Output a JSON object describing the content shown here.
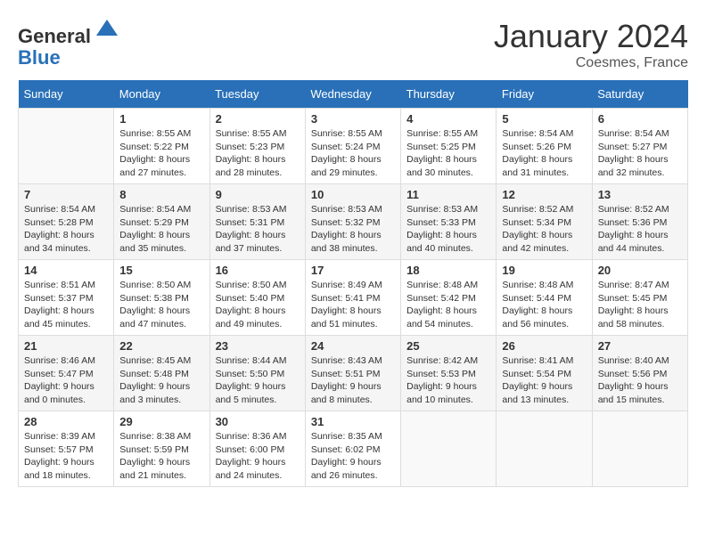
{
  "header": {
    "logo_line1": "General",
    "logo_line2": "Blue",
    "month_title": "January 2024",
    "location": "Coesmes, France"
  },
  "days_of_week": [
    "Sunday",
    "Monday",
    "Tuesday",
    "Wednesday",
    "Thursday",
    "Friday",
    "Saturday"
  ],
  "weeks": [
    [
      {
        "day": "",
        "info": ""
      },
      {
        "day": "1",
        "info": "Sunrise: 8:55 AM\nSunset: 5:22 PM\nDaylight: 8 hours\nand 27 minutes."
      },
      {
        "day": "2",
        "info": "Sunrise: 8:55 AM\nSunset: 5:23 PM\nDaylight: 8 hours\nand 28 minutes."
      },
      {
        "day": "3",
        "info": "Sunrise: 8:55 AM\nSunset: 5:24 PM\nDaylight: 8 hours\nand 29 minutes."
      },
      {
        "day": "4",
        "info": "Sunrise: 8:55 AM\nSunset: 5:25 PM\nDaylight: 8 hours\nand 30 minutes."
      },
      {
        "day": "5",
        "info": "Sunrise: 8:54 AM\nSunset: 5:26 PM\nDaylight: 8 hours\nand 31 minutes."
      },
      {
        "day": "6",
        "info": "Sunrise: 8:54 AM\nSunset: 5:27 PM\nDaylight: 8 hours\nand 32 minutes."
      }
    ],
    [
      {
        "day": "7",
        "info": "Sunrise: 8:54 AM\nSunset: 5:28 PM\nDaylight: 8 hours\nand 34 minutes."
      },
      {
        "day": "8",
        "info": "Sunrise: 8:54 AM\nSunset: 5:29 PM\nDaylight: 8 hours\nand 35 minutes."
      },
      {
        "day": "9",
        "info": "Sunrise: 8:53 AM\nSunset: 5:31 PM\nDaylight: 8 hours\nand 37 minutes."
      },
      {
        "day": "10",
        "info": "Sunrise: 8:53 AM\nSunset: 5:32 PM\nDaylight: 8 hours\nand 38 minutes."
      },
      {
        "day": "11",
        "info": "Sunrise: 8:53 AM\nSunset: 5:33 PM\nDaylight: 8 hours\nand 40 minutes."
      },
      {
        "day": "12",
        "info": "Sunrise: 8:52 AM\nSunset: 5:34 PM\nDaylight: 8 hours\nand 42 minutes."
      },
      {
        "day": "13",
        "info": "Sunrise: 8:52 AM\nSunset: 5:36 PM\nDaylight: 8 hours\nand 44 minutes."
      }
    ],
    [
      {
        "day": "14",
        "info": "Sunrise: 8:51 AM\nSunset: 5:37 PM\nDaylight: 8 hours\nand 45 minutes."
      },
      {
        "day": "15",
        "info": "Sunrise: 8:50 AM\nSunset: 5:38 PM\nDaylight: 8 hours\nand 47 minutes."
      },
      {
        "day": "16",
        "info": "Sunrise: 8:50 AM\nSunset: 5:40 PM\nDaylight: 8 hours\nand 49 minutes."
      },
      {
        "day": "17",
        "info": "Sunrise: 8:49 AM\nSunset: 5:41 PM\nDaylight: 8 hours\nand 51 minutes."
      },
      {
        "day": "18",
        "info": "Sunrise: 8:48 AM\nSunset: 5:42 PM\nDaylight: 8 hours\nand 54 minutes."
      },
      {
        "day": "19",
        "info": "Sunrise: 8:48 AM\nSunset: 5:44 PM\nDaylight: 8 hours\nand 56 minutes."
      },
      {
        "day": "20",
        "info": "Sunrise: 8:47 AM\nSunset: 5:45 PM\nDaylight: 8 hours\nand 58 minutes."
      }
    ],
    [
      {
        "day": "21",
        "info": "Sunrise: 8:46 AM\nSunset: 5:47 PM\nDaylight: 9 hours\nand 0 minutes."
      },
      {
        "day": "22",
        "info": "Sunrise: 8:45 AM\nSunset: 5:48 PM\nDaylight: 9 hours\nand 3 minutes."
      },
      {
        "day": "23",
        "info": "Sunrise: 8:44 AM\nSunset: 5:50 PM\nDaylight: 9 hours\nand 5 minutes."
      },
      {
        "day": "24",
        "info": "Sunrise: 8:43 AM\nSunset: 5:51 PM\nDaylight: 9 hours\nand 8 minutes."
      },
      {
        "day": "25",
        "info": "Sunrise: 8:42 AM\nSunset: 5:53 PM\nDaylight: 9 hours\nand 10 minutes."
      },
      {
        "day": "26",
        "info": "Sunrise: 8:41 AM\nSunset: 5:54 PM\nDaylight: 9 hours\nand 13 minutes."
      },
      {
        "day": "27",
        "info": "Sunrise: 8:40 AM\nSunset: 5:56 PM\nDaylight: 9 hours\nand 15 minutes."
      }
    ],
    [
      {
        "day": "28",
        "info": "Sunrise: 8:39 AM\nSunset: 5:57 PM\nDaylight: 9 hours\nand 18 minutes."
      },
      {
        "day": "29",
        "info": "Sunrise: 8:38 AM\nSunset: 5:59 PM\nDaylight: 9 hours\nand 21 minutes."
      },
      {
        "day": "30",
        "info": "Sunrise: 8:36 AM\nSunset: 6:00 PM\nDaylight: 9 hours\nand 24 minutes."
      },
      {
        "day": "31",
        "info": "Sunrise: 8:35 AM\nSunset: 6:02 PM\nDaylight: 9 hours\nand 26 minutes."
      },
      {
        "day": "",
        "info": ""
      },
      {
        "day": "",
        "info": ""
      },
      {
        "day": "",
        "info": ""
      }
    ]
  ]
}
